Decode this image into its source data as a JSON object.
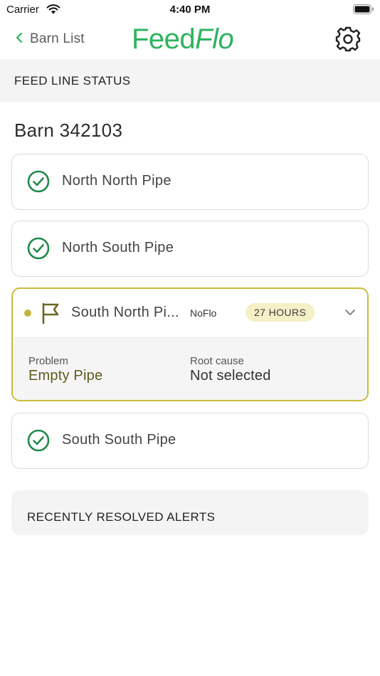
{
  "status_bar": {
    "carrier": "Carrier",
    "time": "4:40 PM"
  },
  "nav": {
    "back_label": "Barn List",
    "logo_part1": "Feed",
    "logo_part2": "Flo"
  },
  "section": {
    "title": "FEED LINE STATUS"
  },
  "barn": {
    "title": "Barn 342103"
  },
  "pipes": [
    {
      "name": "North North Pipe",
      "status": "ok"
    },
    {
      "name": "North South Pipe",
      "status": "ok"
    },
    {
      "name": "South North Pi...",
      "status": "alert",
      "alert_type": "NoFlo",
      "duration": "27 HOURS",
      "problem_label": "Problem",
      "problem_value": "Empty Pipe",
      "root_cause_label": "Root cause",
      "root_cause_value": "Not selected"
    },
    {
      "name": "South South Pipe",
      "status": "ok"
    }
  ],
  "resolved": {
    "title": "RECENTLY RESOLVED ALERTS"
  },
  "colors": {
    "brand_green": "#2eb35e",
    "check_green": "#1f8a4c",
    "alert_border": "#c9bb3a",
    "flag_color": "#6e6724",
    "badge_bg": "#f6f0c6"
  },
  "icons": {
    "back": "chevron-left-icon",
    "settings": "gear-icon",
    "ok": "check-circle-icon",
    "alert": "flag-icon",
    "expand": "chevron-down-icon"
  }
}
